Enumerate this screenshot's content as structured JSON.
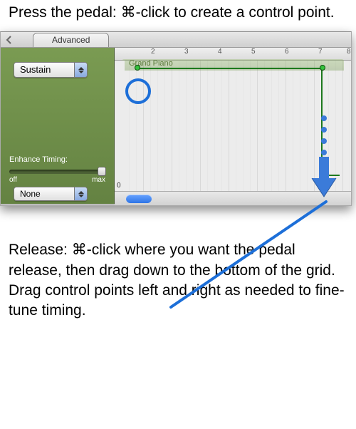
{
  "caption_top": "Press the pedal: ⌘-click to create a control point.",
  "caption_bottom": "Release: ⌘-click where you want the pedal release, then drag down to the bottom of the grid. Drag control points left and right as needed to fine-tune timing.",
  "tab_label": "Advanced",
  "param_dropdown": "Sustain",
  "enhance_label": "Enhance Timing:",
  "slider_off": "off",
  "slider_max": "max",
  "quantize_dropdown": "None",
  "track_name": "Grand Piano",
  "ruler_zero": "0",
  "ruler_marks": [
    "2",
    "3",
    "4",
    "5",
    "6",
    "7",
    "8"
  ]
}
